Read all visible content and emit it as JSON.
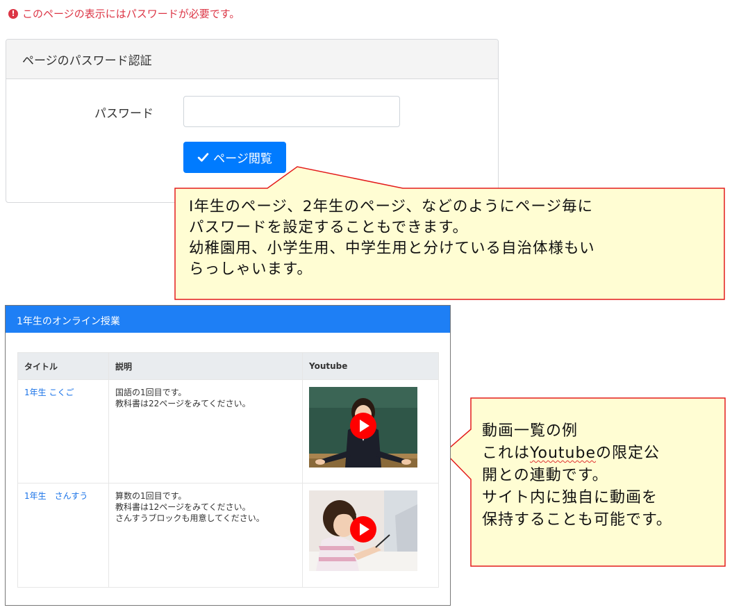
{
  "alert": {
    "icon": "exclamation-circle-icon",
    "text": "このページの表示にはパスワードが必要です。"
  },
  "auth_card": {
    "title": "ページのパスワード認証",
    "password_label": "パスワード",
    "password_value": "",
    "view_button_label": "ページ閲覧",
    "view_button_icon": "check-icon"
  },
  "callout_password": {
    "lines": [
      "I年生のページ、2年生のページ、などのようにページ毎に",
      "パスワードを設定することもできます。",
      "幼稚園用、小学生用、中学生用と分けている自治体様もい",
      "らっしゃいます。"
    ]
  },
  "video_panel": {
    "title": "1年生のオンライン授業",
    "columns": [
      "タイトル",
      "説明",
      "Youtube"
    ],
    "rows": [
      {
        "title": "1年生 こくご",
        "description": [
          "国語の1回目です。",
          "教科書は22ページをみてください。"
        ],
        "thumbnail": "teacher-classroom-video-thumbnail"
      },
      {
        "title": "1年生　さんすう",
        "description": [
          "算数の1回目です。",
          "教科書は12ページをみてください。",
          "さんすうブロックも用意してください。"
        ],
        "thumbnail": "girl-studying-video-thumbnail"
      }
    ]
  },
  "callout_video": {
    "line1": "動画一覧の例",
    "line2_before": "これは",
    "line2_word": "Youtube",
    "line2_after": "の限定公",
    "line3": "開との連動です。",
    "line4": "サイト内に独自に動画を",
    "line5": "保持することも可能です。"
  },
  "colors": {
    "alert_red": "#dc3545",
    "primary_blue": "#007bff",
    "panel_header_blue": "#1e7ff5",
    "callout_fill": "#fffdd3",
    "callout_border": "#e31b1b",
    "link_blue": "#1a73e8"
  }
}
